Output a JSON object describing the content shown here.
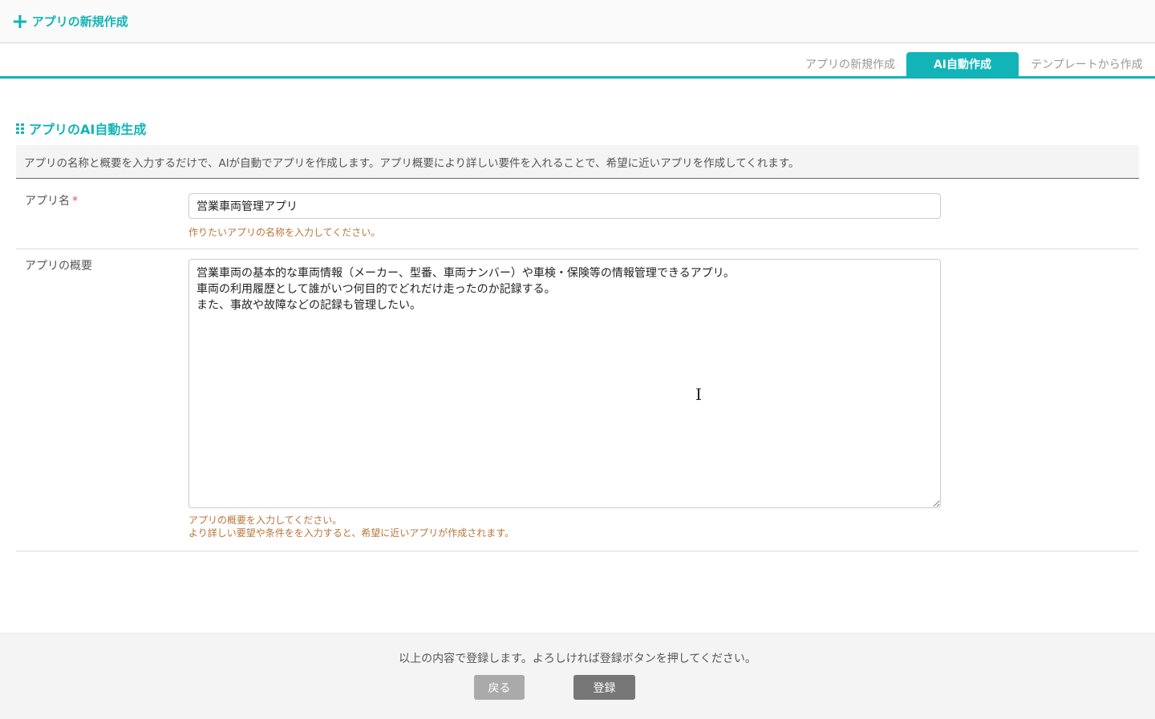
{
  "header": {
    "title": "アプリの新規作成",
    "icon": "plus-icon"
  },
  "tabs": [
    {
      "label": "アプリの新規作成"
    },
    {
      "label": "AI自動作成",
      "active": true
    },
    {
      "label": "テンプレートから作成"
    }
  ],
  "section": {
    "title": "アプリのAI自動生成",
    "description": "アプリの名称と概要を入力するだけで、AIが自動でアプリを作成します。アプリ概要により詳しい要件を入れることで、希望に近いアプリを作成してくれます。"
  },
  "form": {
    "name": {
      "label": "アプリ名",
      "required_mark": "*",
      "value": "営業車両管理アプリ",
      "hint": "作りたいアプリの名称を入力してください。"
    },
    "summary": {
      "label": "アプリの概要",
      "value": "営業車両の基本的な車両情報（メーカー、型番、車両ナンバー）や車検・保険等の情報管理できるアプリ。\n車両の利用履歴として誰がいつ何目的でどれだけ走ったのか記録する。\nまた、事故や故障などの記録も管理したい。",
      "hint1": "アプリの概要を入力してください。",
      "hint2": "より詳しい要望や条件をを入力すると、希望に近いアプリが作成されます。"
    }
  },
  "footer": {
    "message": "以上の内容で登録します。よろしければ登録ボタンを押してください。",
    "back_label": "戻る",
    "submit_label": "登録"
  },
  "colors": {
    "accent": "#12b4b8",
    "hint": "#b8753a",
    "required": "#e05050"
  }
}
